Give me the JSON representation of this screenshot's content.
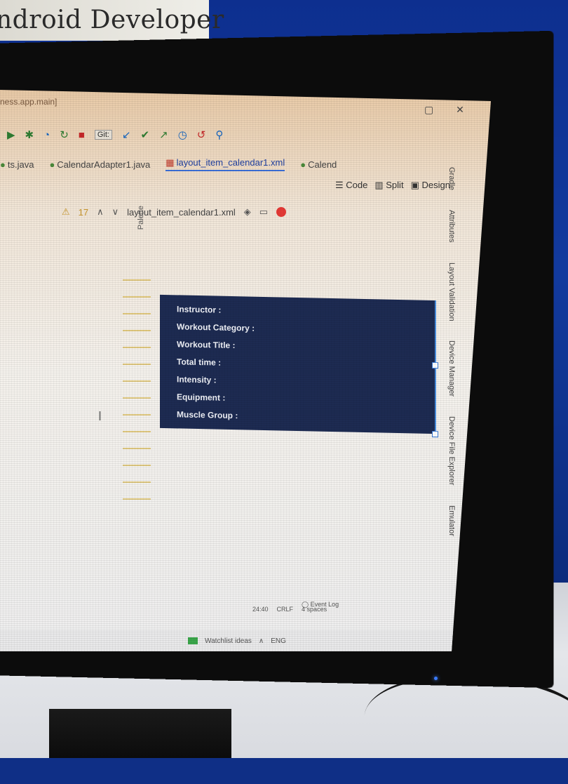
{
  "banner": {
    "text": "ndroid Developer"
  },
  "ide": {
    "title_path": "ness.app.main]",
    "window_controls": "▢ ✕",
    "toolbar": {
      "git_label": "Git:"
    },
    "tabs": [
      {
        "label": "ts.java",
        "icon": "java-file-icon"
      },
      {
        "label": "CalendarAdapter1.java",
        "icon": "java-file-icon"
      },
      {
        "label": "layout_item_calendar1.xml",
        "icon": "xml-file-icon",
        "active": true
      },
      {
        "label": "Calend",
        "icon": "java-file-icon"
      }
    ],
    "view_modes": [
      "Code",
      "Split",
      "Design"
    ],
    "design_toolbar": {
      "warnings": "17",
      "file": "layout_item_calendar1.xml"
    },
    "left_panel": "Palette",
    "right_panels": [
      "Gradle",
      "Attributes",
      "Layout Validation",
      "Device Manager",
      "Device File Explorer",
      "Emulator"
    ],
    "preview_fields": [
      "Instructor :",
      "Workout Category :",
      "Workout Title :",
      "Total time :",
      "Intensity :",
      "Equipment :",
      "Muscle Group :"
    ],
    "status_bar": {
      "event_log": "Event Log",
      "position": "24:40",
      "line_ending": "CRLF",
      "indent": "4 spaces"
    },
    "taskbar": {
      "app": "Watchlist ideas",
      "lang": "ENG"
    }
  }
}
